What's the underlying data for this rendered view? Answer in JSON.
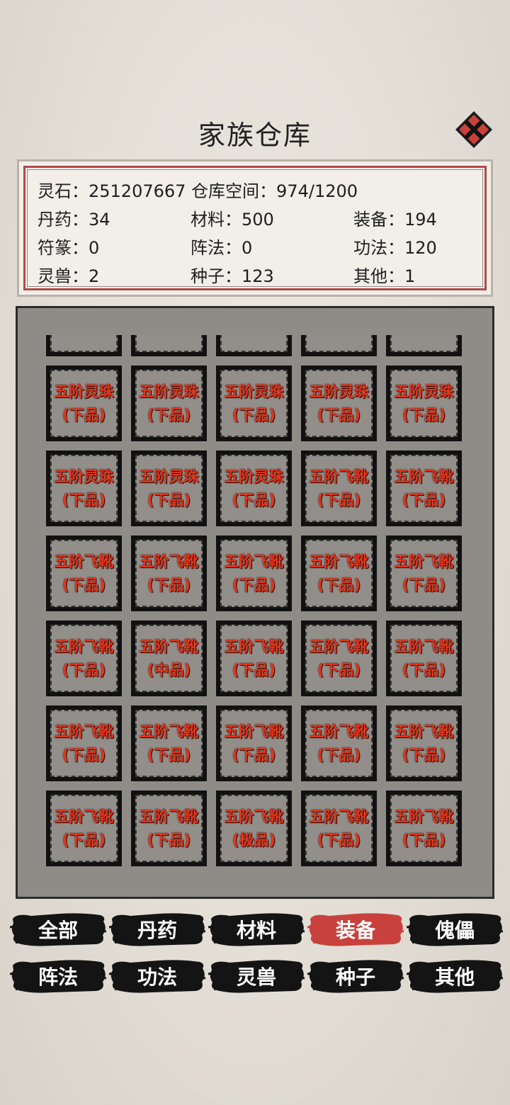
{
  "title": "家族仓库",
  "stats": {
    "line1": "灵石：251207667 仓库空间：974/1200",
    "row2": [
      "丹药：34",
      "材料：500",
      "装备：194"
    ],
    "row3": [
      "符篆：0",
      "阵法：0",
      "功法：120"
    ],
    "row4": [
      "灵兽：2",
      "种子：123",
      "其他：1"
    ]
  },
  "items": [
    {
      "name": "五阶灵珠",
      "grade": "(下品)"
    },
    {
      "name": "五阶灵珠",
      "grade": "(下品)"
    },
    {
      "name": "五阶灵珠",
      "grade": "(下品)"
    },
    {
      "name": "五阶灵珠",
      "grade": "(下品)"
    },
    {
      "name": "五阶灵珠",
      "grade": "(下品)"
    },
    {
      "name": "五阶灵珠",
      "grade": "(下品)"
    },
    {
      "name": "五阶灵珠",
      "grade": "(下品)"
    },
    {
      "name": "五阶灵珠",
      "grade": "(下品)"
    },
    {
      "name": "五阶飞靴",
      "grade": "(下品)"
    },
    {
      "name": "五阶飞靴",
      "grade": "(下品)"
    },
    {
      "name": "五阶飞靴",
      "grade": "(下品)"
    },
    {
      "name": "五阶飞靴",
      "grade": "(下品)"
    },
    {
      "name": "五阶飞靴",
      "grade": "(下品)"
    },
    {
      "name": "五阶飞靴",
      "grade": "(下品)"
    },
    {
      "name": "五阶飞靴",
      "grade": "(下品)"
    },
    {
      "name": "五阶飞靴",
      "grade": "(下品)"
    },
    {
      "name": "五阶飞靴",
      "grade": "(中品)"
    },
    {
      "name": "五阶飞靴",
      "grade": "(下品)"
    },
    {
      "name": "五阶飞靴",
      "grade": "(下品)"
    },
    {
      "name": "五阶飞靴",
      "grade": "(下品)"
    },
    {
      "name": "五阶飞靴",
      "grade": "(下品)"
    },
    {
      "name": "五阶飞靴",
      "grade": "(下品)"
    },
    {
      "name": "五阶飞靴",
      "grade": "(下品)"
    },
    {
      "name": "五阶飞靴",
      "grade": "(下品)"
    },
    {
      "name": "五阶飞靴",
      "grade": "(下品)"
    },
    {
      "name": "五阶飞靴",
      "grade": "(下品)"
    },
    {
      "name": "五阶飞靴",
      "grade": "(下品)"
    },
    {
      "name": "五阶飞靴",
      "grade": "(极品)"
    },
    {
      "name": "五阶飞靴",
      "grade": "(下品)"
    },
    {
      "name": "五阶飞靴",
      "grade": "(下品)"
    }
  ],
  "tabs": [
    {
      "label": "全部",
      "active": false
    },
    {
      "label": "丹药",
      "active": false
    },
    {
      "label": "材料",
      "active": false
    },
    {
      "label": "装备",
      "active": true
    },
    {
      "label": "傀儡",
      "active": false
    },
    {
      "label": "阵法",
      "active": false
    },
    {
      "label": "功法",
      "active": false
    },
    {
      "label": "灵兽",
      "active": false
    },
    {
      "label": "种子",
      "active": false
    },
    {
      "label": "其他",
      "active": false
    }
  ],
  "colors": {
    "active_tab": "#c9413d",
    "tab": "#141414",
    "item_text": "#e2361c",
    "close_bg": "#c9413d"
  },
  "icons": {
    "close": "close-x-icon"
  }
}
